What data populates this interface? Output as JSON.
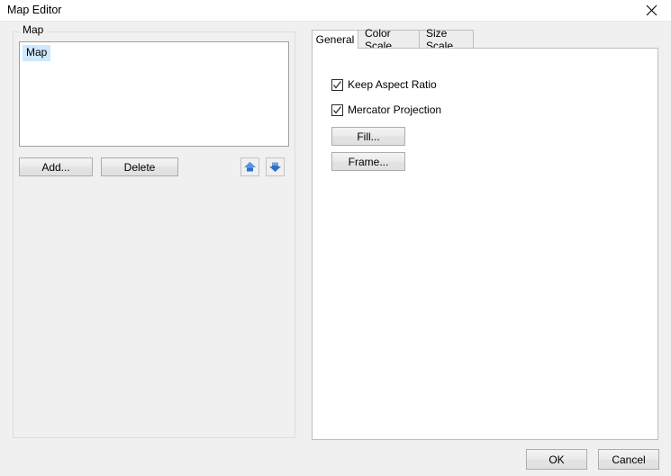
{
  "window": {
    "title": "Map Editor",
    "close_icon": "close-icon"
  },
  "left_panel": {
    "group_label": "Map",
    "list": {
      "items": [
        {
          "label": "Map",
          "selected": true
        }
      ]
    },
    "buttons": {
      "add_label": "Add...",
      "delete_label": "Delete",
      "move_up_icon": "arrow-up-icon",
      "move_down_icon": "arrow-down-icon"
    }
  },
  "right_panel": {
    "tabs": [
      {
        "label": "General",
        "active": true
      },
      {
        "label": "Color Scale",
        "active": false
      },
      {
        "label": "Size Scale",
        "active": false
      }
    ],
    "general": {
      "checkboxes": [
        {
          "label": "Keep Aspect Ratio",
          "checked": true
        },
        {
          "label": "Mercator Projection",
          "checked": true
        }
      ],
      "fill_label": "Fill...",
      "frame_label": "Frame..."
    }
  },
  "footer": {
    "ok_label": "OK",
    "cancel_label": "Cancel"
  },
  "colors": {
    "dialog_background": "#f0f0f0",
    "titlebar_background": "#ffffff",
    "panel_background": "#ffffff",
    "selection_highlight": "#cde8ff",
    "arrow_blue": "#2f6fc4",
    "border": "#bebebe"
  }
}
